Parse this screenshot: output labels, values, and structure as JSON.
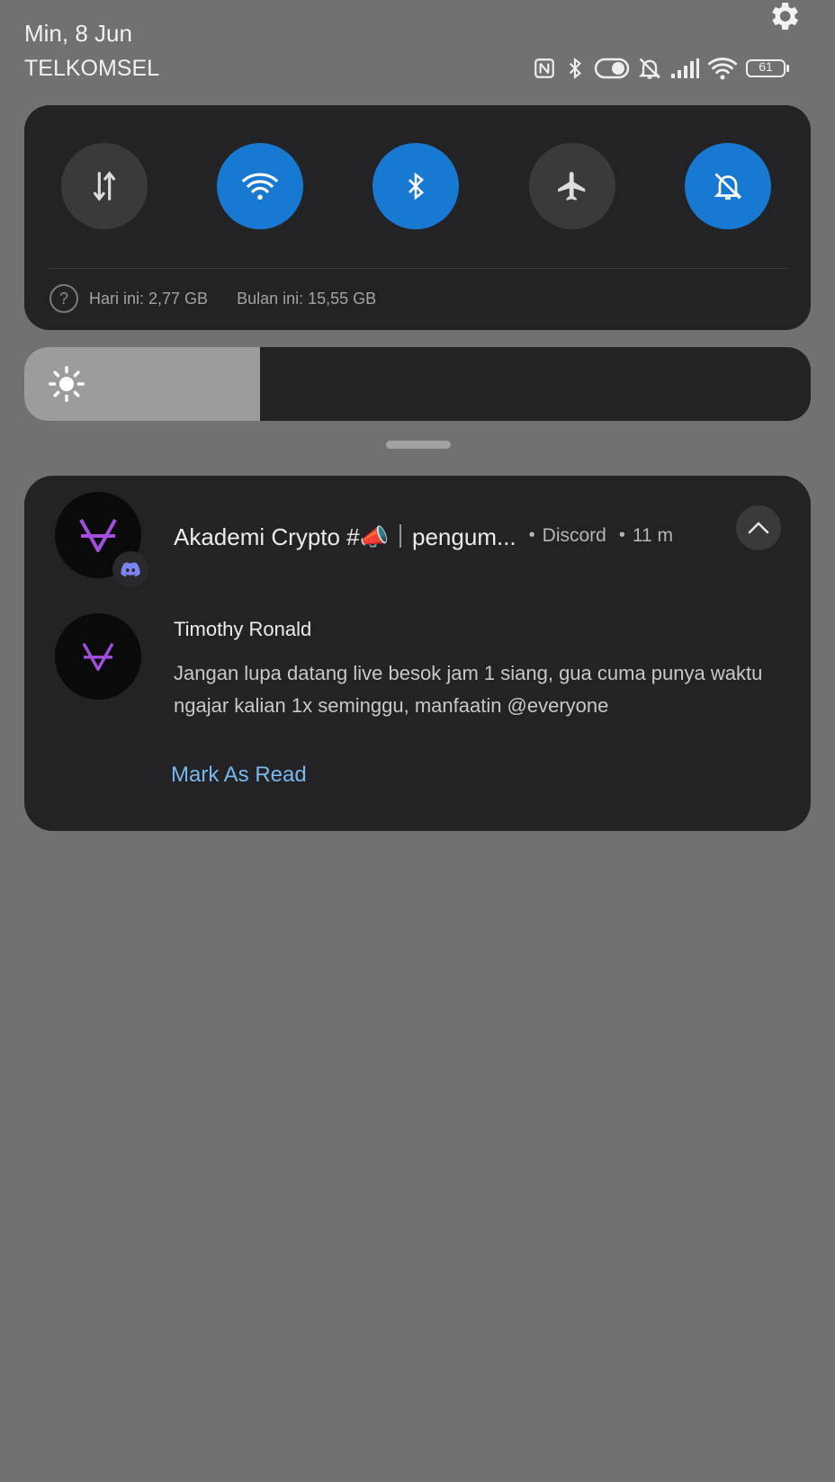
{
  "status_bar": {
    "date": "Min, 8 Jun",
    "carrier": "TELKOMSEL",
    "settings_icon": "gear-icon",
    "icons": [
      "nfc-icon",
      "bluetooth-icon",
      "toggle-icon",
      "mute-bell-icon",
      "signal-icon",
      "wifi-icon",
      "battery-icon"
    ],
    "battery_level": "61"
  },
  "quick_settings": {
    "tiles": [
      {
        "name": "mobile-data",
        "icon": "data-transfer-icon",
        "active": false
      },
      {
        "name": "wifi",
        "icon": "wifi-icon",
        "active": true
      },
      {
        "name": "bluetooth",
        "icon": "bluetooth-icon",
        "active": true
      },
      {
        "name": "airplane-mode",
        "icon": "airplane-icon",
        "active": false
      },
      {
        "name": "silent-mode",
        "icon": "mute-bell-icon",
        "active": true
      }
    ],
    "usage_today": "Hari ini: 2,77 GB",
    "usage_month": "Bulan ini: 15,55 GB",
    "accent_color": "#1879d2"
  },
  "brightness": {
    "level_fraction": 0.3,
    "icon": "brightness-icon"
  },
  "notification": {
    "title": "Akademi Crypto #📣｜pengum...",
    "app": "Discord",
    "time": "11 m",
    "sender": "Timothy Ronald",
    "message": "Jangan lupa datang live besok jam 1 siang, gua cuma punya waktu ngajar kalian 1x seminggu, manfaatin @everyone",
    "action_label": "Mark As Read",
    "app_badge_icon": "discord-icon",
    "brand_color": "#a24ee0"
  }
}
